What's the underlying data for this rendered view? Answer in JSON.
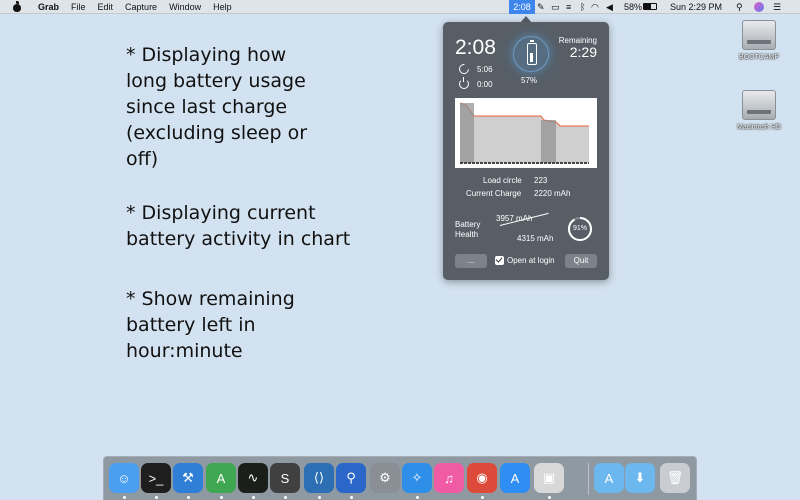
{
  "menubar": {
    "app_name": "Grab",
    "items": [
      "File",
      "Edit",
      "Capture",
      "Window",
      "Help"
    ],
    "status_clock": "2:08",
    "battery_pct": "58%",
    "datetime": "Sun 2:29 PM"
  },
  "description": {
    "block1": [
      "* Displaying how",
      "long battery usage",
      "since last charge",
      "(excluding sleep or",
      "off)"
    ],
    "block2": [
      "* Displaying current",
      "battery activity in chart"
    ],
    "block3": [
      "* Show remaining",
      "battery left in",
      "hour:minute"
    ]
  },
  "popover": {
    "usage_time": "2:08",
    "sleep_time": "5:06",
    "off_time": "0:00",
    "battery_percent": "57%",
    "remaining_label": "Remaining",
    "remaining_time": "2:29",
    "load_circle_label": "Load circle",
    "load_circle_value": "223",
    "current_charge_label": "Current Charge",
    "current_charge_value": "2220 mAh",
    "health_label_line1": "Battery",
    "health_label_line2": "Health",
    "health_current": "3957 mAh",
    "health_design": "4315 mAh",
    "health_percent": "91%",
    "health_fraction": 0.91,
    "more_button": "...",
    "open_at_login_label": "Open at login",
    "open_at_login_checked": true,
    "quit_button": "Quit",
    "accent_color": "#3e86ec",
    "chart_line_color": "#e8623a"
  },
  "desktop": {
    "drives": [
      {
        "label": "BOOTCAMP"
      },
      {
        "label": "Macintosh HD"
      }
    ]
  },
  "dock": {
    "apps": [
      {
        "name": "finder-icon",
        "color": "#4a9ff0",
        "glyph": "☺",
        "running": true
      },
      {
        "name": "terminal-icon",
        "color": "#1e1e1e",
        "glyph": ">_",
        "running": true
      },
      {
        "name": "xcode-icon",
        "color": "#2f7fd6",
        "glyph": "⚒",
        "running": true
      },
      {
        "name": "android-studio-icon",
        "color": "#3fa652",
        "glyph": "A",
        "running": true
      },
      {
        "name": "activity-monitor-icon",
        "color": "#1a1f1a",
        "glyph": "∿",
        "running": true
      },
      {
        "name": "sublime-text-icon",
        "color": "#404040",
        "glyph": "S",
        "running": true
      },
      {
        "name": "vscode-icon",
        "color": "#2c6fb3",
        "glyph": "⟨⟩",
        "running": true
      },
      {
        "name": "sourcetree-icon",
        "color": "#2a67c9",
        "glyph": "⚲",
        "running": true
      },
      {
        "name": "system-preferences-icon",
        "color": "#8a8f96",
        "glyph": "⚙",
        "running": false
      },
      {
        "name": "safari-icon",
        "color": "#2e8ee8",
        "glyph": "✧",
        "running": true
      },
      {
        "name": "itunes-icon",
        "color": "#f15ba5",
        "glyph": "♫",
        "running": false
      },
      {
        "name": "chrome-icon",
        "color": "#dd4a3a",
        "glyph": "◉",
        "running": true
      },
      {
        "name": "app-store-icon",
        "color": "#2f8ef3",
        "glyph": "A",
        "running": false
      },
      {
        "name": "preview-icon",
        "color": "#d8d8d8",
        "glyph": "▣",
        "running": true
      },
      {
        "name": "applications-folder-icon",
        "color": "#6cb7ee",
        "glyph": "A",
        "running": false
      },
      {
        "name": "downloads-folder-icon",
        "color": "#6cb7ee",
        "glyph": "⬇",
        "running": false
      },
      {
        "name": "trash-icon",
        "color": "#c9cdd1",
        "glyph": "🗑",
        "running": false
      }
    ]
  }
}
